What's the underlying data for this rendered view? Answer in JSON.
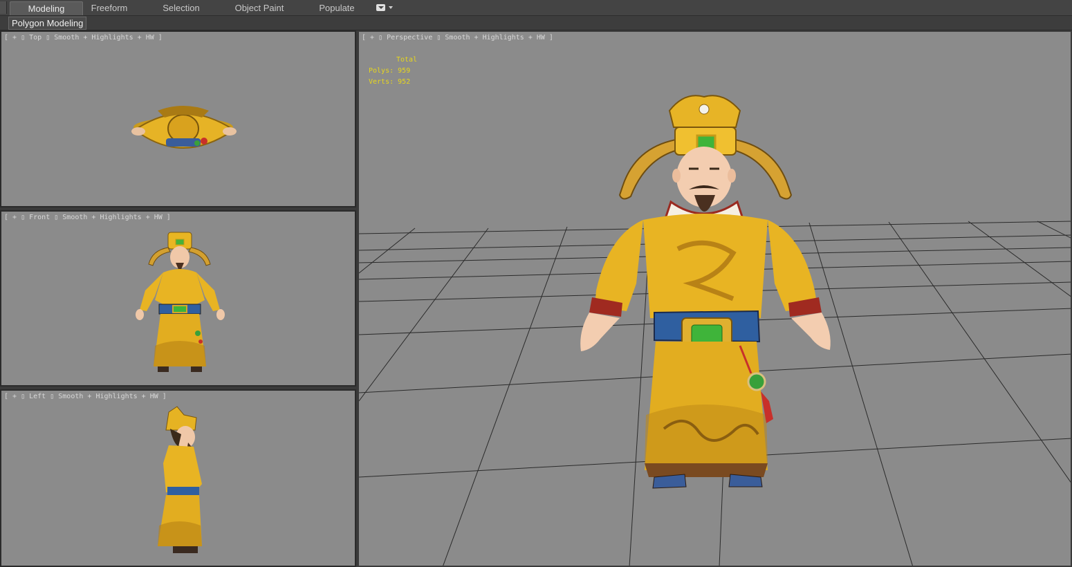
{
  "ribbon": {
    "tabs": [
      {
        "label": "Modeling",
        "active": true
      },
      {
        "label": "Freeform",
        "active": false
      },
      {
        "label": "Selection",
        "active": false
      },
      {
        "label": "Object Paint",
        "active": false
      },
      {
        "label": "Populate",
        "active": false
      }
    ],
    "dropdown_icon": "chevron-down-icon"
  },
  "subbar": {
    "active_panel": "Polygon Modeling"
  },
  "viewports": {
    "top": {
      "label": "[ + ▯ Top ▯ Smooth + Highlights + HW ]"
    },
    "front": {
      "label": "[ + ▯ Front ▯ Smooth + Highlights + HW ]"
    },
    "left": {
      "label": "[ + ▯ Left ▯ Smooth + Highlights + HW ]"
    },
    "perspective": {
      "label": "[ + ▯ Perspective ▯ Smooth + Highlights + HW ]"
    }
  },
  "stats": {
    "header": "Total",
    "polys_label": "Polys:",
    "polys_value": "959",
    "verts_label": "Verts:",
    "verts_value": "952"
  },
  "colors": {
    "viewport_bg": "#8b8b8b",
    "robe": "#e8b423",
    "stats_text": "#e7d61d",
    "grid": "#2a2a2a"
  }
}
